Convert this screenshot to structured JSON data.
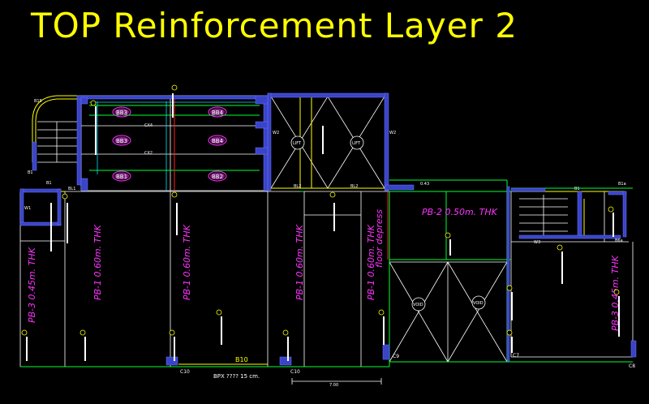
{
  "title": "TOP Reinforcement  Layer 2",
  "colors": {
    "background": "#000000",
    "title": "#ffff00",
    "wall": "#3a44c8",
    "slab_label": "#ff33ff",
    "green_line": "#00ff33",
    "grid_white": "#ffffff",
    "red_line": "#ff2020"
  },
  "slab_labels": {
    "pb3_left": "PB-3 0.45m. THK",
    "pb1_a": "PB-1 0.60m. THK",
    "pb1_b": "PB-1 0.60m. THK",
    "pb1_c": "PB-1 0.60m. THK",
    "pb1_d": "PB-1 0.60m. THK",
    "floor_depress": "floor depress",
    "pb2": "PB-2 0.50m. THK",
    "pb3_right": "PB-3 0.45m. THK"
  },
  "beam_markers": {
    "bb1": "BB1",
    "bb2": "BB2",
    "bb3": "BB3",
    "bb4": "BB4",
    "bb3_top": "BB3",
    "bb4_top": "BB4"
  },
  "labels": {
    "lift_1": "LIFT",
    "lift_2": "LIFT",
    "void_1": "VOID",
    "void_2": "VOID",
    "b10": "B10",
    "bpx": "BPX ???? 15 cm.",
    "dim_700": "7.00",
    "c10_a": "C10",
    "c10_b": "C10",
    "c9": "C9",
    "c7": "C7",
    "c8": "C8",
    "b15": "B15",
    "b1_a": "B1",
    "b1_b": "B1",
    "bl1_a": "BL1",
    "bl2_a": "BL2",
    "bl2_b": "BL2",
    "w1": "W1",
    "w2_a": "W2",
    "w2_b": "W2",
    "w3": "W3",
    "b1a": "B1a",
    "b1_c": "B1",
    "b6a": "B6a",
    "dim_043": "0.43",
    "cx4": "CX4",
    "cx2": "CX2"
  }
}
